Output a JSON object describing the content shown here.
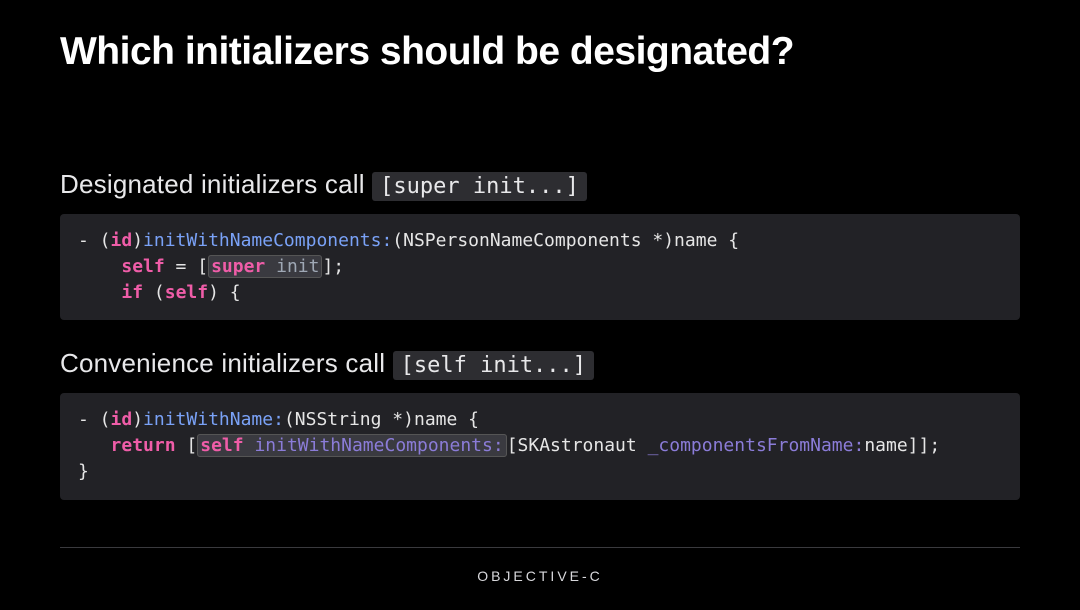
{
  "title": "Which initializers should be designated?",
  "section1": {
    "label_prefix": "Designated initializers call ",
    "label_code": "[super init...]",
    "code": {
      "l1_a": "- (",
      "l1_id": "id",
      "l1_b": ")",
      "l1_sel": "initWithNameComponents:",
      "l1_c": "(NSPersonNameComponents *)name {",
      "l2_a": "    ",
      "l2_self": "self",
      "l2_b": " = [",
      "l2_super": "super",
      "l2_sp": " ",
      "l2_init": "init",
      "l2_c": "];",
      "l3_a": "    ",
      "l3_if": "if",
      "l3_b": " (",
      "l3_self": "self",
      "l3_c": ") {"
    }
  },
  "section2": {
    "label_prefix": "Convenience initializers call ",
    "label_code": "[self init...]",
    "code": {
      "l1_a": "- (",
      "l1_id": "id",
      "l1_b": ")",
      "l1_sel": "initWithName:",
      "l1_c": "(NSString *)name {",
      "l2_a": "   ",
      "l2_ret": "return",
      "l2_b": " [",
      "l2_self": "self",
      "l2_sp": " ",
      "l2_sel": "initWithNameComponents:",
      "l2_c": "[SKAstronaut ",
      "l2_sel2": "_componentsFromName:",
      "l2_d": "name]];",
      "l3": "}"
    }
  },
  "footer": "OBJECTIVE-C"
}
